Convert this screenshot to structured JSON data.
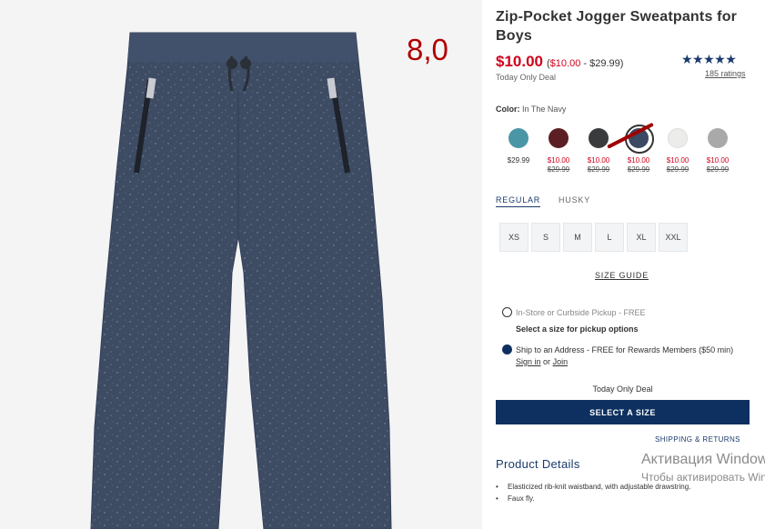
{
  "overlay": {
    "number": "8,0"
  },
  "product": {
    "title": "Zip-Pocket Jogger Sweatpants for Boys",
    "price": "$10.00",
    "price_range_prefix": "(",
    "price_range_sale": "$10.00",
    "price_range_suffix": " - $29.99)",
    "deal": "Today Only Deal",
    "stars": "★★★★★",
    "ratings_link": "185 ratings"
  },
  "color": {
    "label": "Color:",
    "value": "In The Navy",
    "swatches": [
      {
        "name": "teal",
        "hex": "#4a96a6",
        "only": "$29.99",
        "now": "",
        "was": ""
      },
      {
        "name": "burgundy",
        "hex": "#5b1e24",
        "only": "",
        "now": "$10.00",
        "was": "$29.99"
      },
      {
        "name": "charcoal",
        "hex": "#3a3b3d",
        "only": "",
        "now": "$10.00",
        "was": "$29.99"
      },
      {
        "name": "navy",
        "hex": "#3a4a63",
        "only": "",
        "now": "$10.00",
        "was": "$29.99",
        "selected": true
      },
      {
        "name": "cream",
        "hex": "#ececea",
        "only": "",
        "now": "$10.00",
        "was": "$29.99"
      },
      {
        "name": "grey",
        "hex": "#a9a9a9",
        "only": "",
        "now": "$10.00",
        "was": "$29.99"
      }
    ]
  },
  "fit": {
    "tabs": [
      "REGULAR",
      "HUSKY"
    ],
    "active": "REGULAR"
  },
  "sizes": [
    "XS",
    "S",
    "M",
    "L",
    "XL",
    "XXL"
  ],
  "size_guide": "SIZE GUIDE",
  "pickup": {
    "option1": "In-Store or Curbside Pickup - FREE",
    "note": "Select a size for pickup options",
    "option2_text": "Ship to an Address - FREE for Rewards Members ($50 min)",
    "sign_in": "Sign in",
    "or": "or",
    "join": "Join"
  },
  "deal_center": "Today Only Deal",
  "cta": "SELECT A SIZE",
  "shipping_returns": "SHIPPING & RETURNS",
  "details": {
    "title": "Product Details",
    "items": [
      "Elasticized rib-knit waistband, with adjustable drawstring.",
      "Faux fly."
    ]
  },
  "watermark": {
    "line1": "Активация Windows",
    "line2": "Чтобы активировать Windows, перейдите в раздел \"Параметры\"."
  },
  "colors": {
    "brand_navy": "#0e3060",
    "sale_red": "#d0021b",
    "pants_navy": "#3d4b63"
  }
}
